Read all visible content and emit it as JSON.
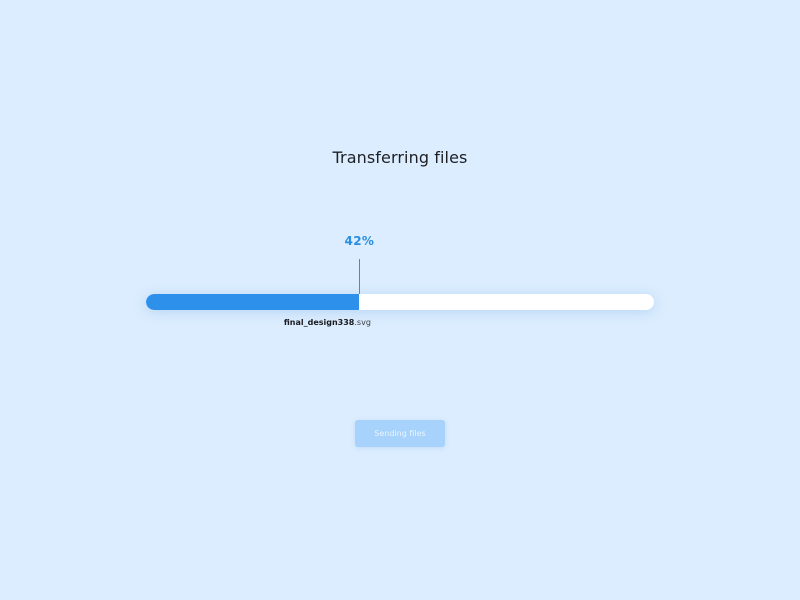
{
  "dialog": {
    "title": "Transferring files"
  },
  "progress": {
    "percent": 42,
    "percent_label": "42%",
    "file_name_base": "final_design338",
    "file_name_ext": ".svg",
    "fill_color": "#2d91ec",
    "track_color": "#ffffff"
  },
  "actions": {
    "send_label": "Sending files"
  },
  "colors": {
    "background": "#dbedfe",
    "accent": "#2d91ec",
    "button_disabled": "#a6d2fb"
  }
}
